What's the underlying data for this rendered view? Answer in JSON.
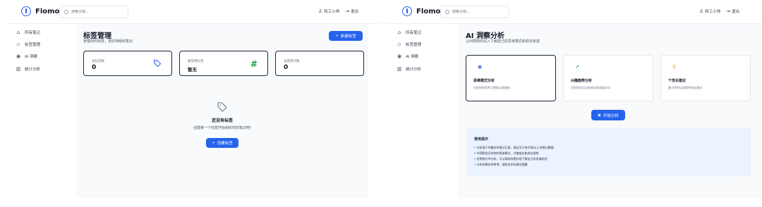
{
  "brand": "Flomo",
  "search_placeholder": "搜索灵感...",
  "user_name": "特工小帅",
  "logout_label": "退出",
  "nav": [
    {
      "label": "所有笔记",
      "icon": "home-icon"
    },
    {
      "label": "标签管理",
      "icon": "tag-icon"
    },
    {
      "label": "AI 洞察",
      "icon": "brain-icon"
    },
    {
      "label": "统计分析",
      "icon": "bar-chart-icon"
    }
  ],
  "tags_page": {
    "title": "标签管理",
    "subtitle": "管理你的标签，更好地组织笔记",
    "new_button": "新建标签",
    "stats": [
      {
        "label": "总标签数",
        "value": "0",
        "icon": "tag-icon",
        "color": "#2563eb"
      },
      {
        "label": "最常用标签",
        "value": "暂无",
        "icon": "hash-icon",
        "color": "#16a34a"
      },
      {
        "label": "总使用次数",
        "value": "0",
        "icon": "",
        "color": ""
      }
    ],
    "empty_title": "还没有标签",
    "empty_subtitle": "创建第一个标签开始组织你的笔记吧!",
    "create_button": "创建标签"
  },
  "ai_page": {
    "title": "AI 洞察分析",
    "subtitle": "让AI帮助你深入了解自己的思考模式和成长轨迹",
    "cards": [
      {
        "title": "思维模式分析",
        "desc": "分析你的思考习惯和心理趋势",
        "icon": "brain-icon",
        "color": "#2563eb"
      },
      {
        "title": "兴趣趋势分析",
        "desc": "识别你关注点的变化和发展方向",
        "icon": "trend-up-icon",
        "color": "#16a34a"
      },
      {
        "title": "个性化建议",
        "desc": "基于你的记录提供成长建议",
        "icon": "lightbulb-icon",
        "color": "#f59e0b"
      }
    ],
    "start_button": "开始分析",
    "tips_title": "使用提示",
    "tips": [
      "• 分析基于你最近的笔记记录，建议至少有10条以上的笔记数据",
      "• AI洞察会识别你的思维模式、兴趣变化和成长趋势",
      "• 定期进行AI分析，可以帮助你更好地了解自己的发展轨迹",
      "• 分析结果仅供参考，请结合实际情况理解"
    ]
  }
}
